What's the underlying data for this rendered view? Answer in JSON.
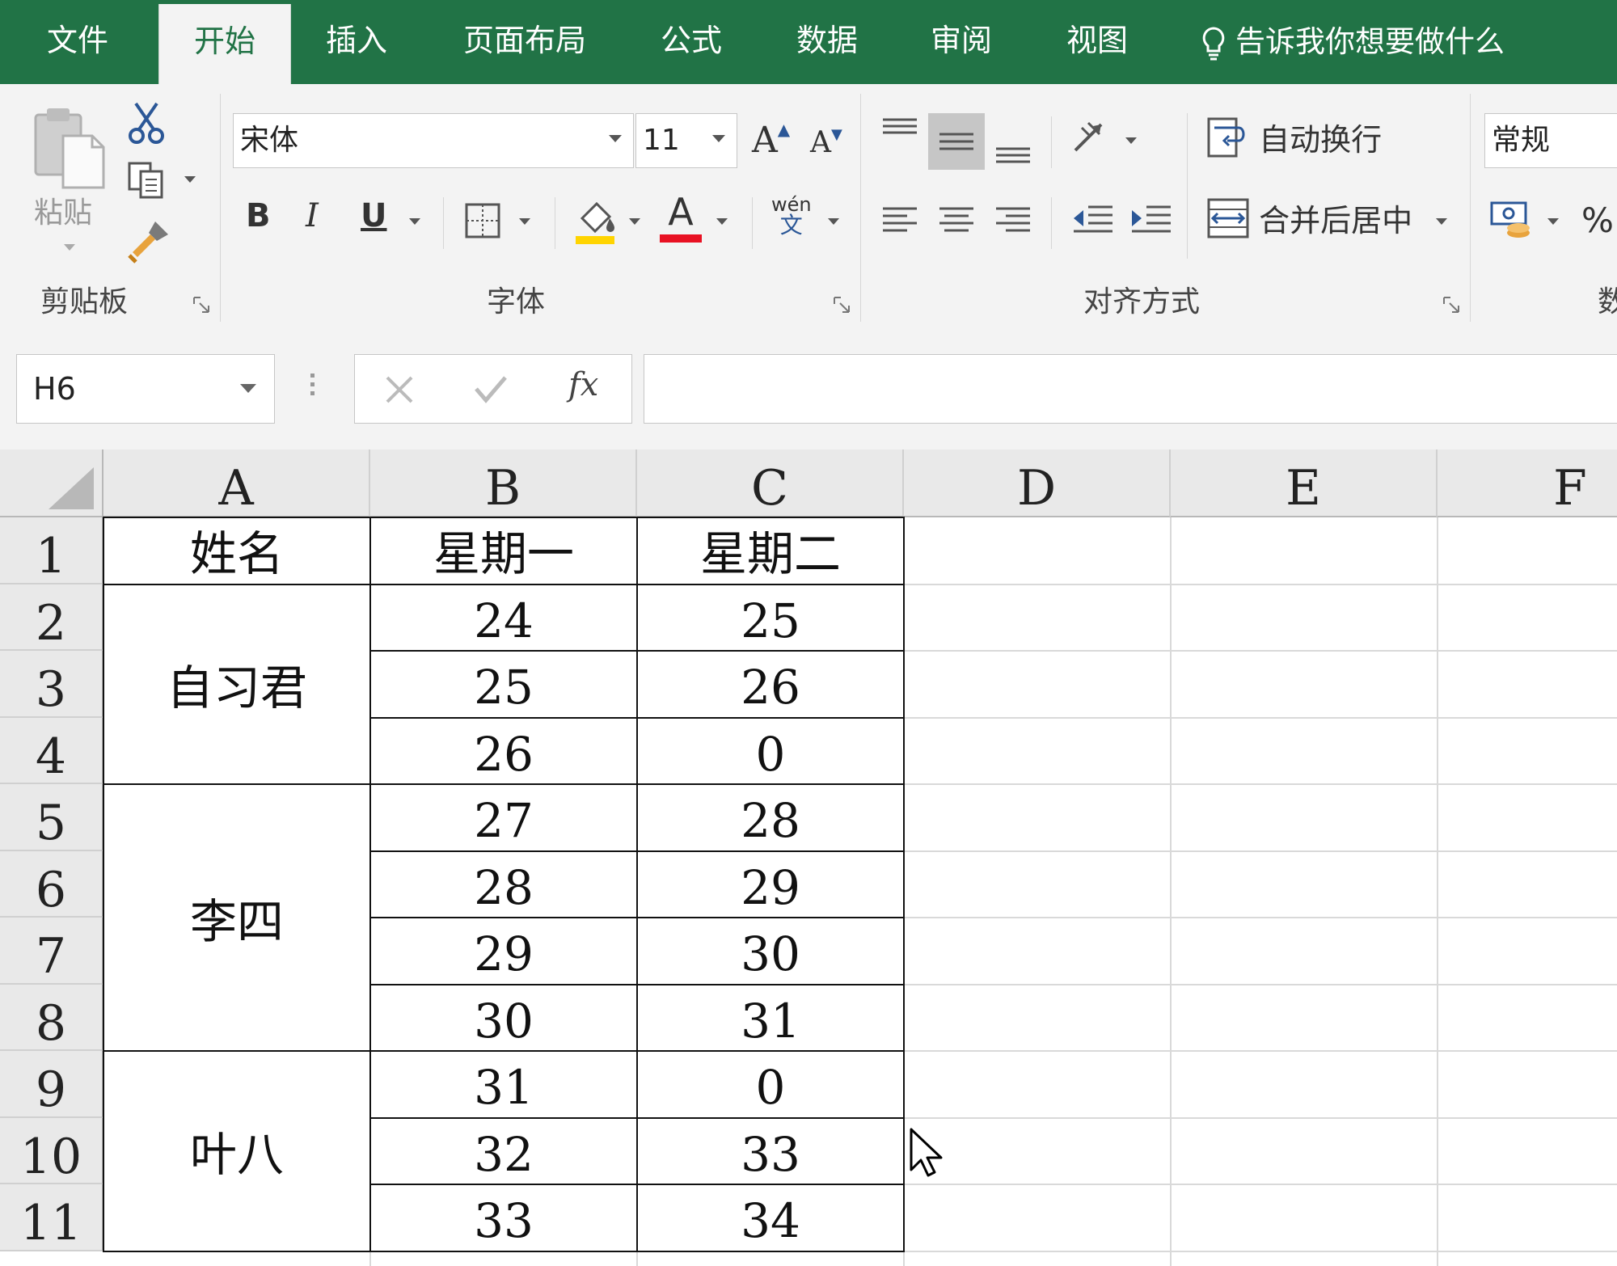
{
  "tabs": [
    "文件",
    "开始",
    "插入",
    "页面布局",
    "公式",
    "数据",
    "审阅",
    "视图"
  ],
  "active_tab": "开始",
  "tell_me": "告诉我你想要做什么",
  "ribbon": {
    "clipboard": {
      "paste_label": "粘贴",
      "group_label": "剪贴板"
    },
    "font": {
      "font_name": "宋体",
      "font_size": "11",
      "grow_label": "A",
      "shrink_label": "A",
      "bold": "B",
      "italic": "I",
      "underline": "U",
      "font_color_label": "A",
      "phonetic_top": "wén",
      "phonetic_bottom": "文",
      "group_label": "字体",
      "font_color": "#e81123",
      "fill_color": "#ffd400"
    },
    "alignment": {
      "wrap_text": "自动换行",
      "merge_center": "合并后居中",
      "group_label": "对齐方式"
    },
    "number": {
      "format": "常规",
      "percent": "%",
      "group_label_partial": "数"
    }
  },
  "formula_bar": {
    "name_box": "H6",
    "fx_label": "fx",
    "value": ""
  },
  "columns": [
    "A",
    "B",
    "C",
    "D",
    "E",
    "F"
  ],
  "rows": [
    "1",
    "2",
    "3",
    "4",
    "5",
    "6",
    "7",
    "8",
    "9",
    "10",
    "11"
  ],
  "table": {
    "headers": [
      "姓名",
      "星期一",
      "星期二"
    ],
    "groups": [
      {
        "name": "自习君",
        "monday": [
          "24",
          "25",
          "26"
        ],
        "tuesday": [
          "25",
          "26",
          "0"
        ]
      },
      {
        "name": "李四",
        "monday": [
          "27",
          "28",
          "29",
          "30"
        ],
        "tuesday": [
          "28",
          "29",
          "30",
          "31"
        ]
      },
      {
        "name": "叶八",
        "monday": [
          "31",
          "32",
          "33"
        ],
        "tuesday": [
          "0",
          "33",
          "34"
        ]
      }
    ]
  },
  "colors": {
    "accent": "#217346",
    "ribbon_bg": "#f3f3f3",
    "header_bg": "#e9e9e9"
  }
}
